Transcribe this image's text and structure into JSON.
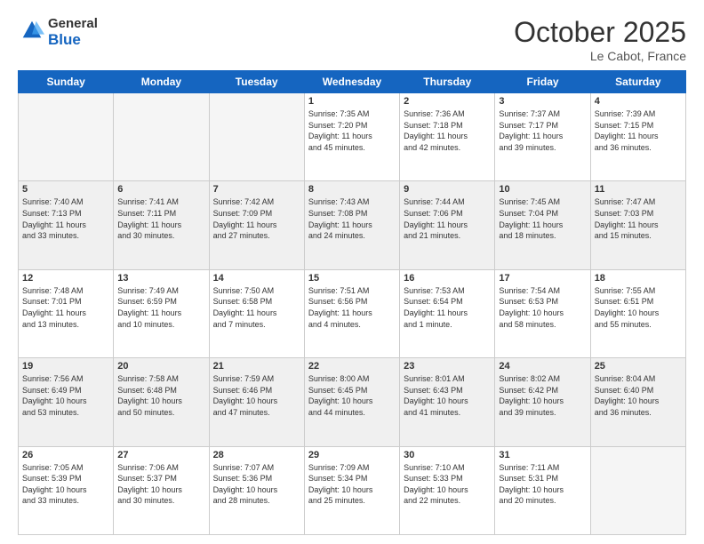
{
  "header": {
    "logo_general": "General",
    "logo_blue": "Blue",
    "month": "October 2025",
    "location": "Le Cabot, France"
  },
  "weekdays": [
    "Sunday",
    "Monday",
    "Tuesday",
    "Wednesday",
    "Thursday",
    "Friday",
    "Saturday"
  ],
  "weeks": [
    [
      {
        "day": "",
        "info": ""
      },
      {
        "day": "",
        "info": ""
      },
      {
        "day": "",
        "info": ""
      },
      {
        "day": "1",
        "info": "Sunrise: 7:35 AM\nSunset: 7:20 PM\nDaylight: 11 hours\nand 45 minutes."
      },
      {
        "day": "2",
        "info": "Sunrise: 7:36 AM\nSunset: 7:18 PM\nDaylight: 11 hours\nand 42 minutes."
      },
      {
        "day": "3",
        "info": "Sunrise: 7:37 AM\nSunset: 7:17 PM\nDaylight: 11 hours\nand 39 minutes."
      },
      {
        "day": "4",
        "info": "Sunrise: 7:39 AM\nSunset: 7:15 PM\nDaylight: 11 hours\nand 36 minutes."
      }
    ],
    [
      {
        "day": "5",
        "info": "Sunrise: 7:40 AM\nSunset: 7:13 PM\nDaylight: 11 hours\nand 33 minutes."
      },
      {
        "day": "6",
        "info": "Sunrise: 7:41 AM\nSunset: 7:11 PM\nDaylight: 11 hours\nand 30 minutes."
      },
      {
        "day": "7",
        "info": "Sunrise: 7:42 AM\nSunset: 7:09 PM\nDaylight: 11 hours\nand 27 minutes."
      },
      {
        "day": "8",
        "info": "Sunrise: 7:43 AM\nSunset: 7:08 PM\nDaylight: 11 hours\nand 24 minutes."
      },
      {
        "day": "9",
        "info": "Sunrise: 7:44 AM\nSunset: 7:06 PM\nDaylight: 11 hours\nand 21 minutes."
      },
      {
        "day": "10",
        "info": "Sunrise: 7:45 AM\nSunset: 7:04 PM\nDaylight: 11 hours\nand 18 minutes."
      },
      {
        "day": "11",
        "info": "Sunrise: 7:47 AM\nSunset: 7:03 PM\nDaylight: 11 hours\nand 15 minutes."
      }
    ],
    [
      {
        "day": "12",
        "info": "Sunrise: 7:48 AM\nSunset: 7:01 PM\nDaylight: 11 hours\nand 13 minutes."
      },
      {
        "day": "13",
        "info": "Sunrise: 7:49 AM\nSunset: 6:59 PM\nDaylight: 11 hours\nand 10 minutes."
      },
      {
        "day": "14",
        "info": "Sunrise: 7:50 AM\nSunset: 6:58 PM\nDaylight: 11 hours\nand 7 minutes."
      },
      {
        "day": "15",
        "info": "Sunrise: 7:51 AM\nSunset: 6:56 PM\nDaylight: 11 hours\nand 4 minutes."
      },
      {
        "day": "16",
        "info": "Sunrise: 7:53 AM\nSunset: 6:54 PM\nDaylight: 11 hours\nand 1 minute."
      },
      {
        "day": "17",
        "info": "Sunrise: 7:54 AM\nSunset: 6:53 PM\nDaylight: 10 hours\nand 58 minutes."
      },
      {
        "day": "18",
        "info": "Sunrise: 7:55 AM\nSunset: 6:51 PM\nDaylight: 10 hours\nand 55 minutes."
      }
    ],
    [
      {
        "day": "19",
        "info": "Sunrise: 7:56 AM\nSunset: 6:49 PM\nDaylight: 10 hours\nand 53 minutes."
      },
      {
        "day": "20",
        "info": "Sunrise: 7:58 AM\nSunset: 6:48 PM\nDaylight: 10 hours\nand 50 minutes."
      },
      {
        "day": "21",
        "info": "Sunrise: 7:59 AM\nSunset: 6:46 PM\nDaylight: 10 hours\nand 47 minutes."
      },
      {
        "day": "22",
        "info": "Sunrise: 8:00 AM\nSunset: 6:45 PM\nDaylight: 10 hours\nand 44 minutes."
      },
      {
        "day": "23",
        "info": "Sunrise: 8:01 AM\nSunset: 6:43 PM\nDaylight: 10 hours\nand 41 minutes."
      },
      {
        "day": "24",
        "info": "Sunrise: 8:02 AM\nSunset: 6:42 PM\nDaylight: 10 hours\nand 39 minutes."
      },
      {
        "day": "25",
        "info": "Sunrise: 8:04 AM\nSunset: 6:40 PM\nDaylight: 10 hours\nand 36 minutes."
      }
    ],
    [
      {
        "day": "26",
        "info": "Sunrise: 7:05 AM\nSunset: 5:39 PM\nDaylight: 10 hours\nand 33 minutes."
      },
      {
        "day": "27",
        "info": "Sunrise: 7:06 AM\nSunset: 5:37 PM\nDaylight: 10 hours\nand 30 minutes."
      },
      {
        "day": "28",
        "info": "Sunrise: 7:07 AM\nSunset: 5:36 PM\nDaylight: 10 hours\nand 28 minutes."
      },
      {
        "day": "29",
        "info": "Sunrise: 7:09 AM\nSunset: 5:34 PM\nDaylight: 10 hours\nand 25 minutes."
      },
      {
        "day": "30",
        "info": "Sunrise: 7:10 AM\nSunset: 5:33 PM\nDaylight: 10 hours\nand 22 minutes."
      },
      {
        "day": "31",
        "info": "Sunrise: 7:11 AM\nSunset: 5:31 PM\nDaylight: 10 hours\nand 20 minutes."
      },
      {
        "day": "",
        "info": ""
      }
    ]
  ],
  "colors": {
    "header_bg": "#1565c0",
    "shaded_row": "#f0f0f0",
    "empty_cell": "#f5f5f5"
  }
}
